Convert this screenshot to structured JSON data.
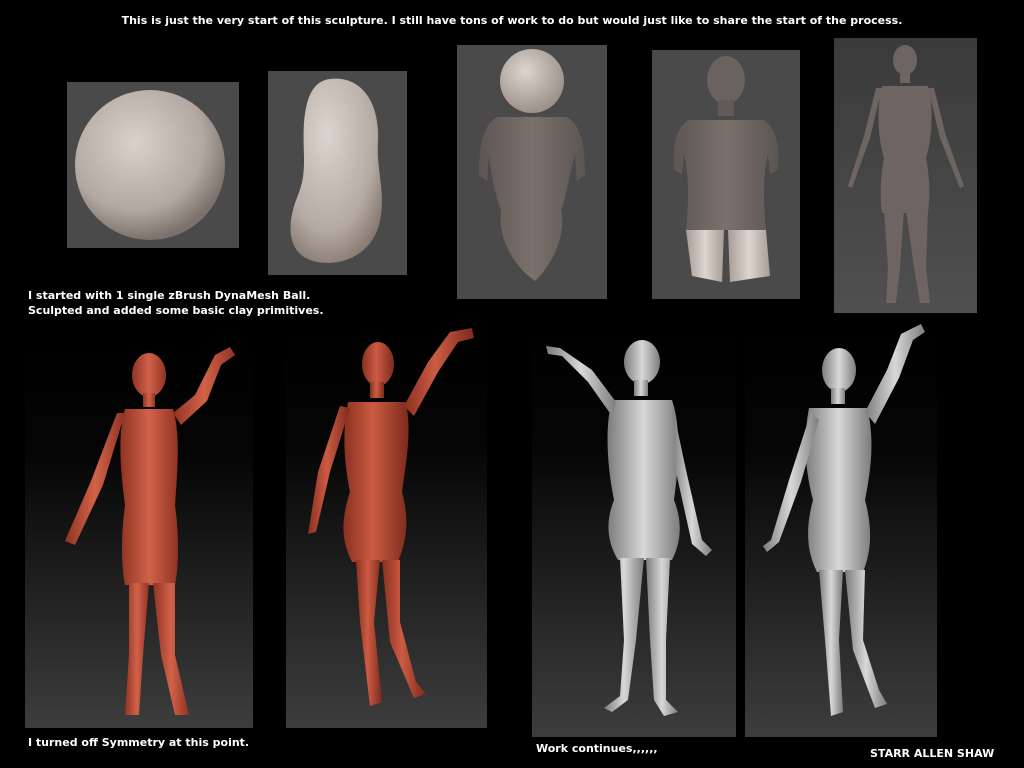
{
  "header": {
    "title": "This is just the very start of this sculpture. I still have tons of work to do but would just like to share the start of the process."
  },
  "captions": {
    "dynamesh_line1": "I started with 1 single zBrush DynaMesh Ball.",
    "dynamesh_line2": "Sculpted and added some basic clay primitives.",
    "symmetry": "I turned off Symmetry at this point.",
    "work": "Work continues,,,,,,",
    "author": "STARR ALLEN SHAW"
  },
  "colors": {
    "clay": "#b7ada6",
    "clay_dark": "#8f827c",
    "red_clay": "#c8553d",
    "red_dark": "#8f3322",
    "gray_sculpt": "#c9c9c9",
    "gray_dark": "#8a8a8a"
  }
}
